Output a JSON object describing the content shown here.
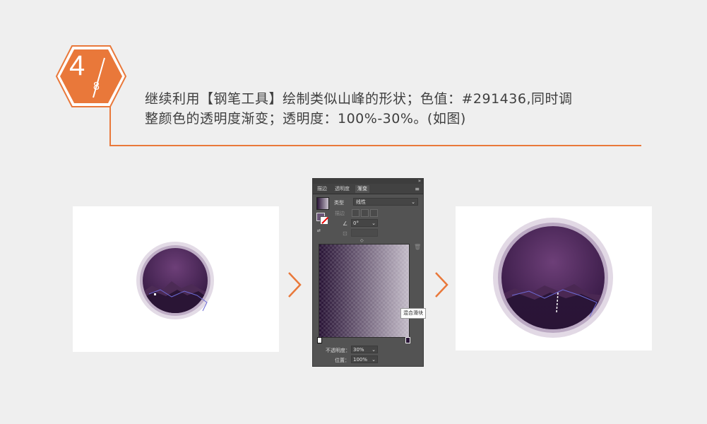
{
  "badge": {
    "step": "4",
    "total": "8",
    "color": "#e9783a"
  },
  "instructions": {
    "line1": "继续利用【钢笔工具】绘制类似山峰的形状；色值：#291436,同时调",
    "line2": "整颜色的透明度渐变；透明度：100%-30%。(如图)"
  },
  "colors": {
    "accent": "#e9783a",
    "shape_color": "#291436",
    "background": "#efefef"
  },
  "gradient_panel": {
    "tabs": [
      "描边",
      "透明度",
      "渐变"
    ],
    "active_tab": "渐变",
    "type_label": "类型",
    "type_value": "线性",
    "stroke_label": "描边",
    "angle_value": "0°",
    "tooltip": "混合滑块",
    "opacity_label": "不透明度：",
    "opacity_value": "30%",
    "location_label": "位置：",
    "location_value": "100%",
    "gradient": {
      "from": "#291436",
      "to_opacity": "30%"
    }
  },
  "icons": {
    "collapse": "double-chevron-icon",
    "menu": "panel-menu-icon",
    "arrow": "chevron-right-icon",
    "trash": "trash-icon",
    "angle": "angle-icon",
    "aspect": "aspect-ratio-icon",
    "reverse": "reverse-gradient-icon"
  }
}
